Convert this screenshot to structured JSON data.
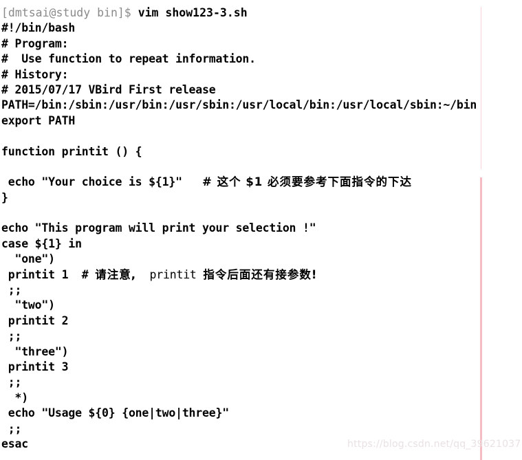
{
  "terminal": {
    "prompt": "[dmtsai@study bin]$ ",
    "command": "vim show123-3.sh",
    "lines": [
      "#!/bin/bash",
      "# Program:",
      "#  Use function to repeat information.",
      "# History:",
      "# 2015/07/17 VBird First release",
      "PATH=/bin:/sbin:/usr/bin:/usr/sbin:/usr/local/bin:/usr/local/sbin:~/bin",
      "export PATH",
      "",
      "function printit () {",
      "",
      " echo \"Your choice is ${1}\"   ",
      "}",
      "",
      "echo \"This program will print your selection !\"",
      "case ${1} in",
      "  \"one\")",
      " printit 1  # ",
      " ;;",
      "  \"two\")",
      " printit 2",
      " ;;",
      "  \"three\")",
      " printit 3",
      " ;;",
      "  *)",
      " echo \"Usage ${0} {one|two|three}\"",
      " ;;",
      "esac"
    ],
    "comment_choice_cjk": "# 这个 $1 必须要参考下面指令的下达",
    "comment_printit_cjk_a": "请注意,",
    "comment_printit_mono": "  printit ",
    "comment_printit_cjk_b": "指令后面还有接参数!"
  },
  "watermark": {
    "text": "https://blog.csdn.net/qq_39621037"
  },
  "colors": {
    "background": "#ffffff",
    "text": "#000000",
    "prompt": "#8a8a8a",
    "rule_faint": "#f7d4d8",
    "rule_strong": "#f6bcc4",
    "watermark": "#e9e1e2"
  }
}
